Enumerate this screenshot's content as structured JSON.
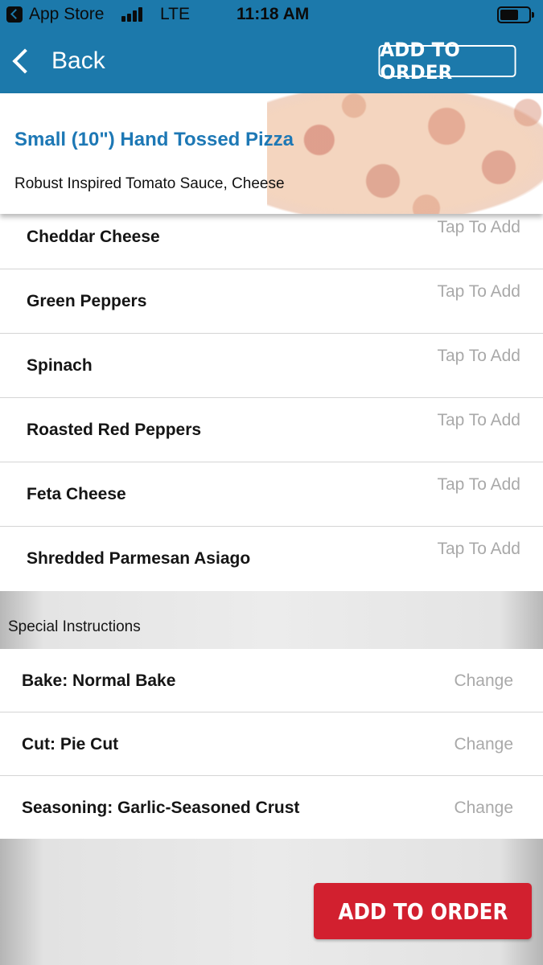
{
  "status_bar": {
    "back_app": "App Store",
    "network": "LTE",
    "time": "11:18 AM"
  },
  "nav": {
    "back_label": "Back",
    "add_to_order_label": "ADD TO ORDER"
  },
  "product": {
    "title": "Small (10\") Hand Tossed Pizza",
    "description": "Robust Inspired Tomato Sauce, Cheese"
  },
  "toppings": [
    {
      "name": "Cheddar Cheese",
      "action": "Tap To Add"
    },
    {
      "name": "Green Peppers",
      "action": "Tap To Add"
    },
    {
      "name": "Spinach",
      "action": "Tap To Add"
    },
    {
      "name": "Roasted Red Peppers",
      "action": "Tap To Add"
    },
    {
      "name": "Feta Cheese",
      "action": "Tap To Add"
    },
    {
      "name": "Shredded Parmesan Asiago",
      "action": "Tap To Add"
    }
  ],
  "special_instructions": {
    "header": "Special Instructions",
    "items": [
      {
        "label": "Bake: Normal Bake",
        "action": "Change"
      },
      {
        "label": "Cut: Pie Cut",
        "action": "Change"
      },
      {
        "label": "Seasoning: Garlic-Seasoned Crust",
        "action": "Change"
      }
    ]
  },
  "footer": {
    "add_to_order_label": "ADD TO ORDER"
  },
  "colors": {
    "nav_blue": "#1c79ab",
    "title_blue": "#1d78b5",
    "cta_red": "#d2202f",
    "muted_gray": "#a9a9a9"
  },
  "icons": {
    "back": "chevron-left-icon",
    "app_back": "app-back-icon",
    "signal": "signal-icon",
    "battery": "battery-icon"
  }
}
